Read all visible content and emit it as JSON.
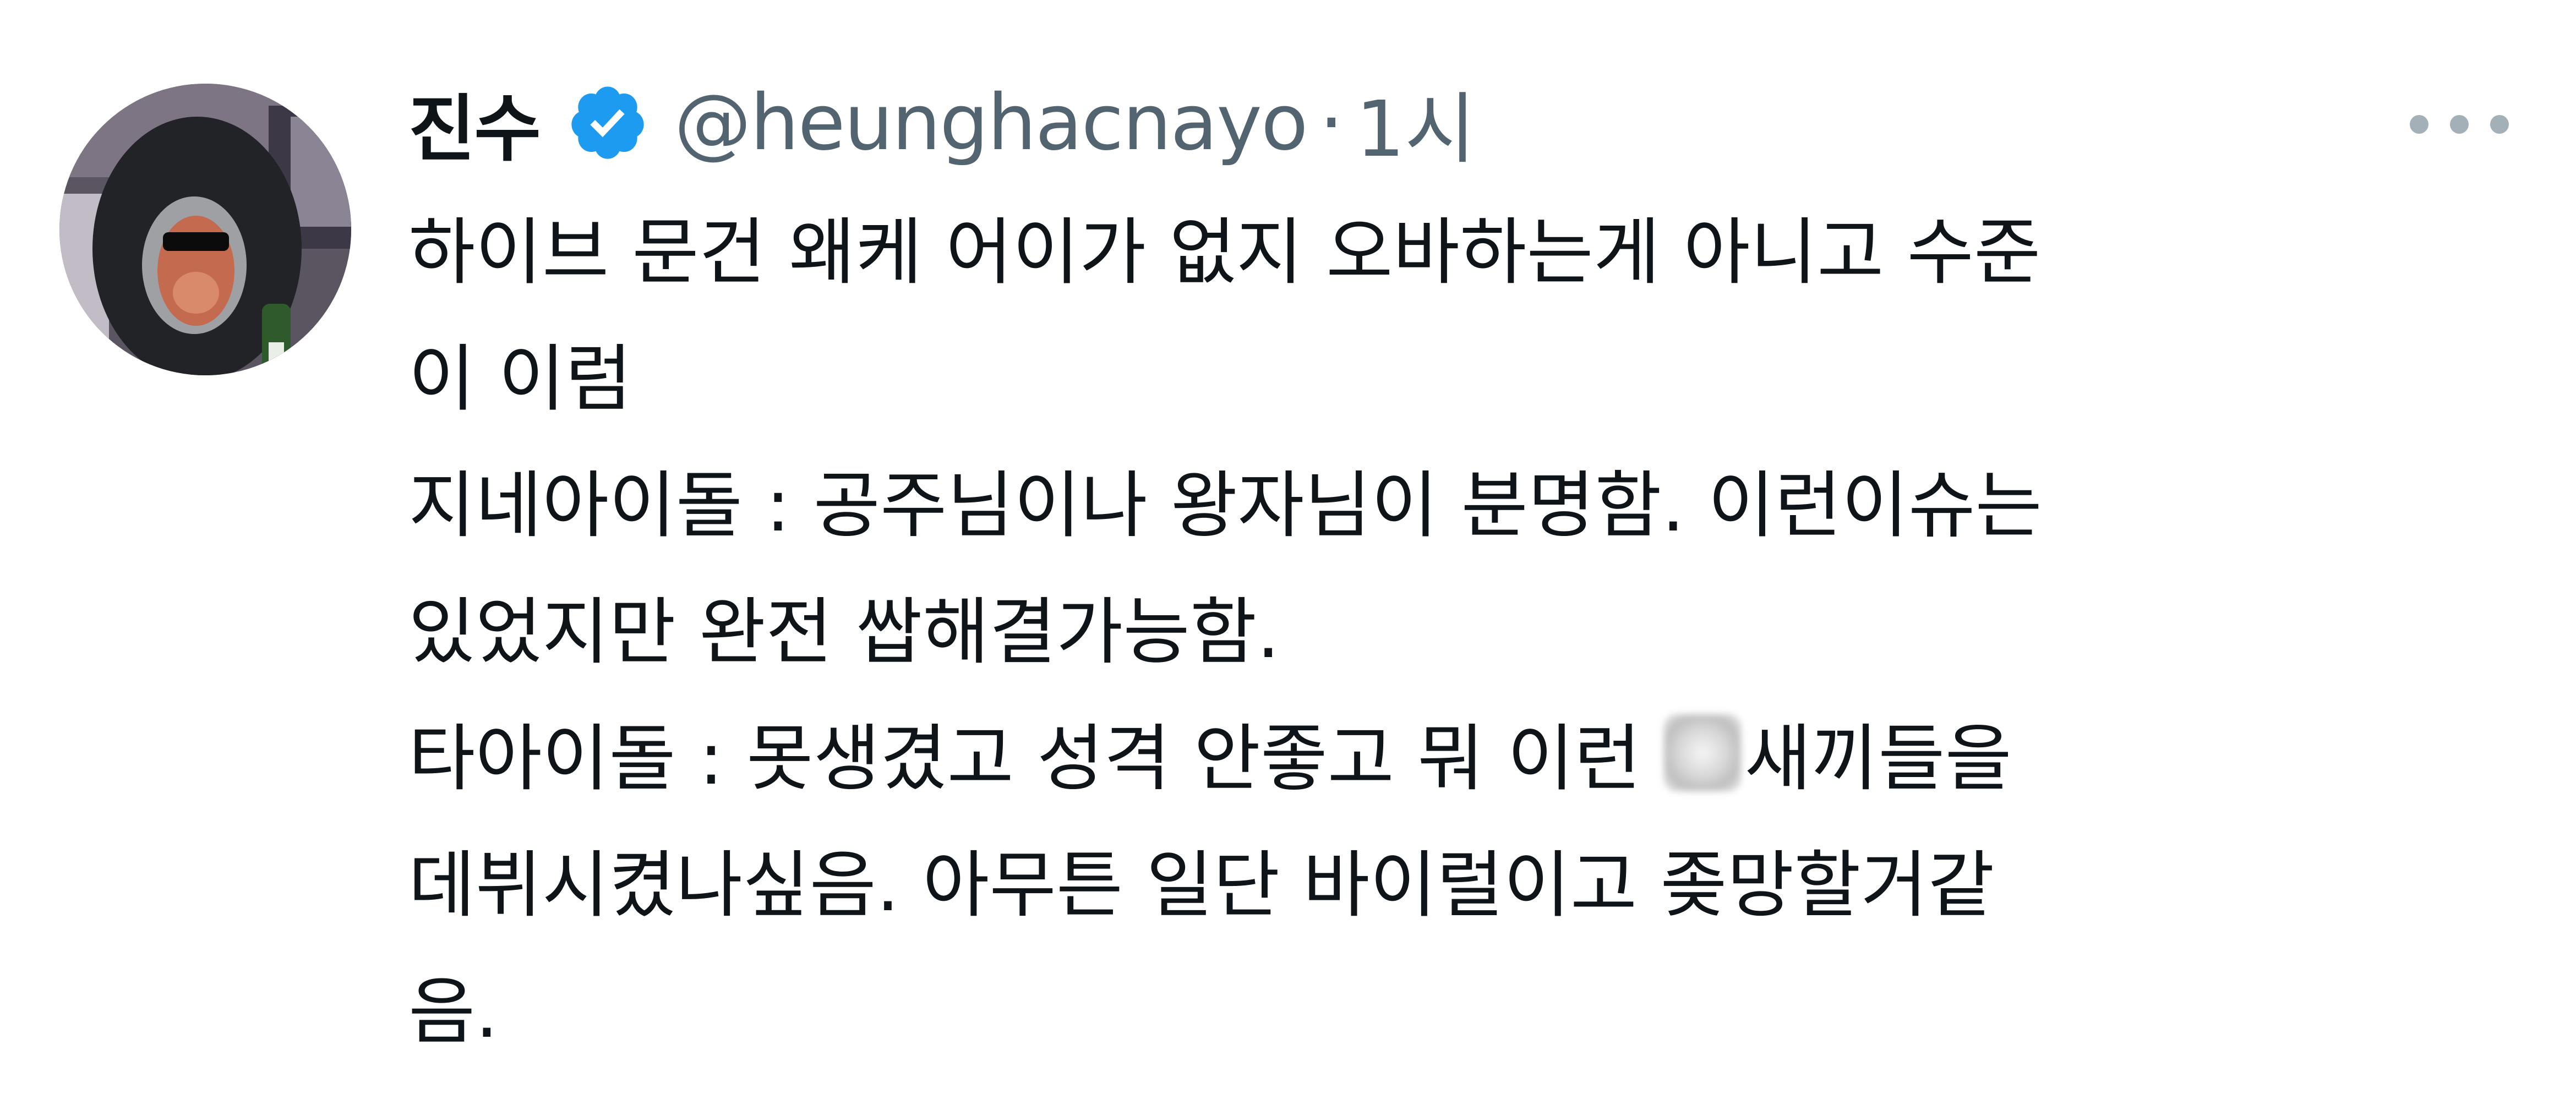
{
  "tweet": {
    "display_name": "진수",
    "verified_icon": "verified-badge-icon",
    "handle": "@heunghacnayo",
    "separator": "·",
    "time": "1시",
    "more_icon": "more-options-icon",
    "avatar_icon": "profile-avatar",
    "lines": [
      "하이브 문건 왜케 어이가 없지 오바하는게 아니고 수준",
      "이 이럼",
      "지네아이돌 : 공주님이나 왕자님이 분명함. 이런이슈는",
      "있었지만 완전 쌉해결가능함.",
      "타아이돌 : 못생겼고 성격 안좋고 뭐 이런 ",
      "새끼들을",
      "데뷔시켰나싶음. 아무튼 일단 바이럴이고 좆망할거같",
      "음."
    ]
  },
  "colors": {
    "verified_blue": "#1d9bf0",
    "text_primary": "#0f1419",
    "text_secondary": "#536471",
    "more_dots": "#a4b0b8"
  }
}
